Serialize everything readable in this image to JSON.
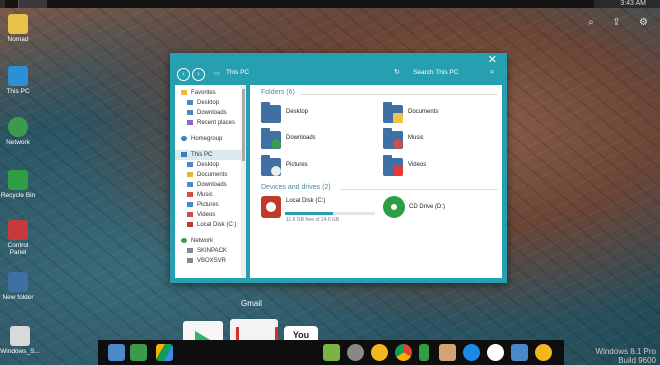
{
  "clock": "3:43 AM",
  "desktop_icons": [
    "Nomad",
    "This PC",
    "Network",
    "Recycle Bin",
    "Control Panel",
    "New folder",
    "Windows_S..."
  ],
  "window": {
    "breadcrumb": "This PC",
    "search_placeholder": "Search This PC",
    "close": "✕"
  },
  "sidebar": {
    "favorites": "Favorites",
    "fav_items": [
      "Desktop",
      "Downloads",
      "Recent places"
    ],
    "homegroup": "Homegroup",
    "thispc": "This PC",
    "pc_items": [
      "Desktop",
      "Documents",
      "Downloads",
      "Music",
      "Pictures",
      "Videos",
      "Local Disk (C:)"
    ],
    "network": "Network",
    "net_items": [
      "SKINPACK",
      "VBOXSVR"
    ]
  },
  "main": {
    "folders_header": "Folders (6)",
    "folders": [
      "Desktop",
      "Documents",
      "Downloads",
      "Music",
      "Pictures",
      "Videos"
    ],
    "drives_header": "Devices and drives (2)",
    "local_disk": {
      "name": "Local Disk (C:)",
      "free": "11.6 GB free of 24.6 GB",
      "used_fraction": 0.53
    },
    "cd_drive": {
      "name": "CD Drive (D:)"
    }
  },
  "dock": {
    "hover_label": "Gmail",
    "youtube_text": "You\nTube"
  },
  "watermark": [
    "Windows 8.1 Pro",
    "Build 9600"
  ]
}
